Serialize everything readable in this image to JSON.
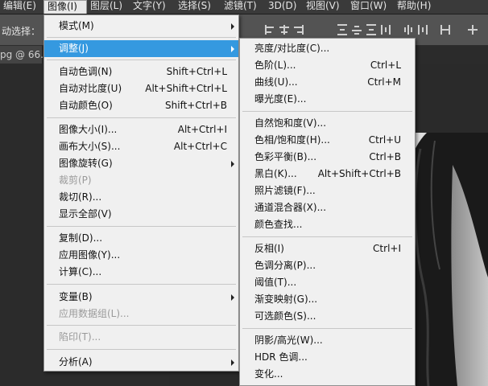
{
  "menubar": {
    "items": [
      {
        "label": "编辑(E)"
      },
      {
        "label": "图像(I)"
      },
      {
        "label": "图层(L)"
      },
      {
        "label": "文字(Y)"
      },
      {
        "label": "选择(S)"
      },
      {
        "label": "滤镜(T)"
      },
      {
        "label": "3D(D)"
      },
      {
        "label": "视图(V)"
      },
      {
        "label": "窗口(W)"
      },
      {
        "label": "帮助(H)"
      }
    ],
    "active": "图像(I)"
  },
  "options_bar": {
    "label": "动选择："
  },
  "document_tab": {
    "label": "pg @ 66.7"
  },
  "image_menu": {
    "items": [
      {
        "label": "模式(M)",
        "submenu": true
      },
      {
        "label": "调整(J)",
        "submenu": true,
        "highlighted": true
      },
      {
        "label": "自动色调(N)",
        "shortcut": "Shift+Ctrl+L"
      },
      {
        "label": "自动对比度(U)",
        "shortcut": "Alt+Shift+Ctrl+L"
      },
      {
        "label": "自动颜色(O)",
        "shortcut": "Shift+Ctrl+B"
      },
      {
        "label": "图像大小(I)...",
        "shortcut": "Alt+Ctrl+I"
      },
      {
        "label": "画布大小(S)...",
        "shortcut": "Alt+Ctrl+C"
      },
      {
        "label": "图像旋转(G)",
        "submenu": true
      },
      {
        "label": "裁剪(P)",
        "disabled": true
      },
      {
        "label": "裁切(R)..."
      },
      {
        "label": "显示全部(V)"
      },
      {
        "label": "复制(D)..."
      },
      {
        "label": "应用图像(Y)..."
      },
      {
        "label": "计算(C)..."
      },
      {
        "label": "变量(B)",
        "submenu": true
      },
      {
        "label": "应用数据组(L)...",
        "disabled": true
      },
      {
        "label": "陷印(T)...",
        "disabled": true
      },
      {
        "label": "分析(A)",
        "submenu": true
      }
    ]
  },
  "adjust_menu": {
    "items": [
      {
        "label": "亮度/对比度(C)..."
      },
      {
        "label": "色阶(L)...",
        "shortcut": "Ctrl+L"
      },
      {
        "label": "曲线(U)...",
        "shortcut": "Ctrl+M"
      },
      {
        "label": "曝光度(E)..."
      },
      {
        "label": "自然饱和度(V)..."
      },
      {
        "label": "色相/饱和度(H)...",
        "shortcut": "Ctrl+U"
      },
      {
        "label": "色彩平衡(B)...",
        "shortcut": "Ctrl+B"
      },
      {
        "label": "黑白(K)...",
        "shortcut": "Alt+Shift+Ctrl+B"
      },
      {
        "label": "照片滤镜(F)..."
      },
      {
        "label": "通道混合器(X)..."
      },
      {
        "label": "颜色查找..."
      },
      {
        "label": "反相(I)",
        "shortcut": "Ctrl+I"
      },
      {
        "label": "色调分离(P)..."
      },
      {
        "label": "阈值(T)..."
      },
      {
        "label": "渐变映射(G)..."
      },
      {
        "label": "可选颜色(S)..."
      },
      {
        "label": "阴影/高光(W)..."
      },
      {
        "label": "HDR 色调..."
      },
      {
        "label": "变化..."
      }
    ]
  },
  "colors": {
    "highlight": "#3599e0",
    "menu_bg": "#f0f0f0",
    "app_bg": "#2b2b2b",
    "menubar_bg": "#3a3a3a"
  }
}
